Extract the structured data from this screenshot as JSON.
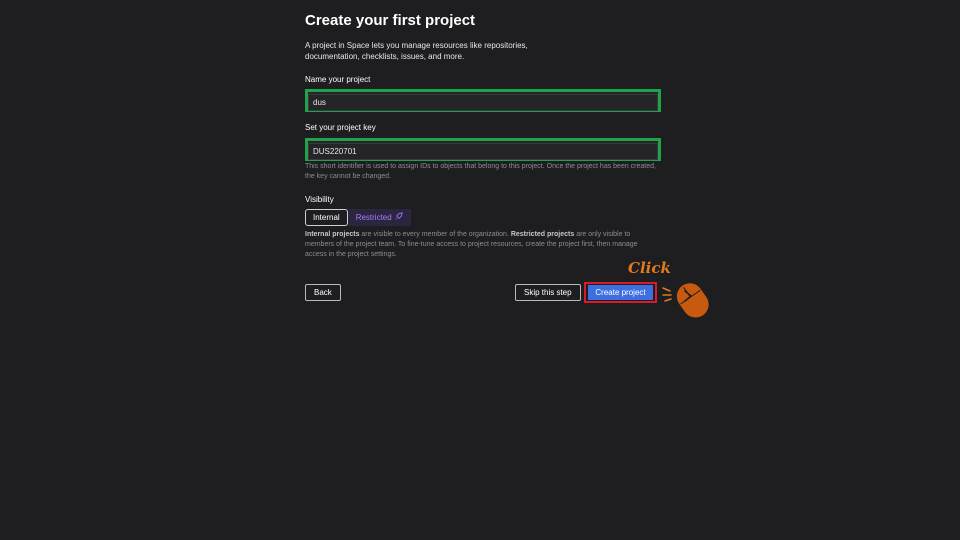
{
  "header": {
    "title": "Create your first project",
    "intro": "A project in Space lets you manage resources like repositories, documentation, checklists, issues, and more."
  },
  "name_field": {
    "label": "Name your project",
    "value": "dus"
  },
  "key_field": {
    "label": "Set your project key",
    "value": "DUS220701",
    "hint": "This short identifier is used to assign IDs to objects that belong to this project. Once the project has been created, the key cannot be changed."
  },
  "visibility": {
    "label": "Visibility",
    "options": [
      {
        "label": "Internal",
        "selected": true
      },
      {
        "label": "Restricted",
        "selected": false,
        "icon": "rocket-icon"
      }
    ],
    "description": {
      "internal_term": "Internal projects",
      "internal_text": " are visible to every member of the organization. ",
      "restricted_term": "Restricted projects",
      "restricted_text": " are only visible to members of the project team. To fine-tune access to project resources, create the project first, then manage access in the project settings."
    }
  },
  "actions": {
    "back_label": "Back",
    "skip_label": "Skip this step",
    "create_label": "Create project"
  },
  "annotation": {
    "click_text": "Click",
    "icon": "mouse-icon"
  },
  "colors": {
    "background": "#1e1e20",
    "field_highlight": "#1fa34a",
    "primary_button": "#3d6fe0",
    "create_highlight": "#d81b2c",
    "restricted_accent": "#a67cff",
    "annotation": "#e07a1f"
  }
}
